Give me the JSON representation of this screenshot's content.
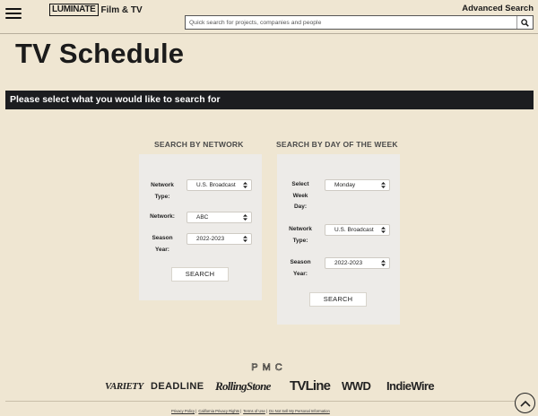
{
  "header": {
    "logo_main": "LUMINATE",
    "logo_sub": "Film & TV",
    "advanced_search": "Advanced Search",
    "search_placeholder": "Quick search for projects, companies and people"
  },
  "page": {
    "title": "TV Schedule",
    "banner": "Please select what you would like to search for"
  },
  "network_search": {
    "title": "SEARCH BY NETWORK",
    "network_type_label": [
      "Network",
      "Type:"
    ],
    "network_type_value": "U.S. Broadcast",
    "network_label": "Network:",
    "network_value": "ABC",
    "season_year_label": [
      "Season",
      "Year:"
    ],
    "season_year_value": "2022-2023",
    "button": "SEARCH"
  },
  "day_search": {
    "title": "SEARCH BY DAY OF THE WEEK",
    "week_day_label": [
      "Select",
      "Week",
      "Day:"
    ],
    "week_day_value": "Monday",
    "network_type_label": [
      "Network",
      "Type:"
    ],
    "network_type_value": "U.S. Broadcast",
    "season_year_label": [
      "Season",
      "Year:"
    ],
    "season_year_value": "2022-2023",
    "button": "SEARCH"
  },
  "footer": {
    "pmc": "PMC",
    "brands": [
      "VARIETY",
      "DEADLINE",
      "RollingStone",
      "TVLine",
      "WWD",
      "IndieWire"
    ],
    "legal": [
      "Privacy Policy",
      "California Privacy Rights",
      "Terms of Use",
      "Do Not Sell My Personal Information"
    ]
  },
  "icons": {
    "menu": "hamburger-menu-icon",
    "search": "search-icon",
    "select": "sort-arrows-icon",
    "scroll": "chevron-up-icon"
  }
}
